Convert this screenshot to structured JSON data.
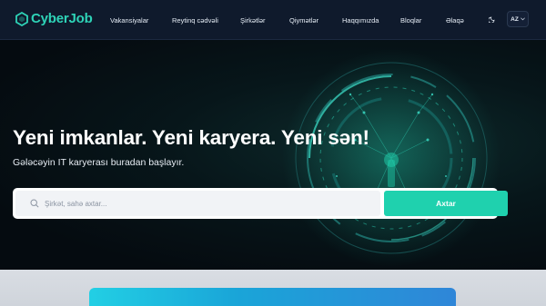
{
  "brand": {
    "name": "CyberJob",
    "accent": "#2ed3b7"
  },
  "nav": {
    "items": [
      {
        "label": "Vakansiyalar"
      },
      {
        "label": "Reytinq cədvəli"
      },
      {
        "label": "Şirkətlər"
      },
      {
        "label": "Qiymətlər"
      },
      {
        "label": "Haqqımızda"
      },
      {
        "label": "Bloqlar"
      },
      {
        "label": "Əlaqə"
      }
    ],
    "theme_icon": "moon-icon",
    "language": "AZ"
  },
  "hero": {
    "title": "Yeni imkanlar. Yeni karyera. Yeni sən!",
    "subtitle": "Gələcəyin IT karyerası buradan başlayır.",
    "search": {
      "placeholder": "Şirkət, sahə axtar...",
      "value": "",
      "button_label": "Axtar",
      "button_color": "#1fd1ae"
    }
  }
}
